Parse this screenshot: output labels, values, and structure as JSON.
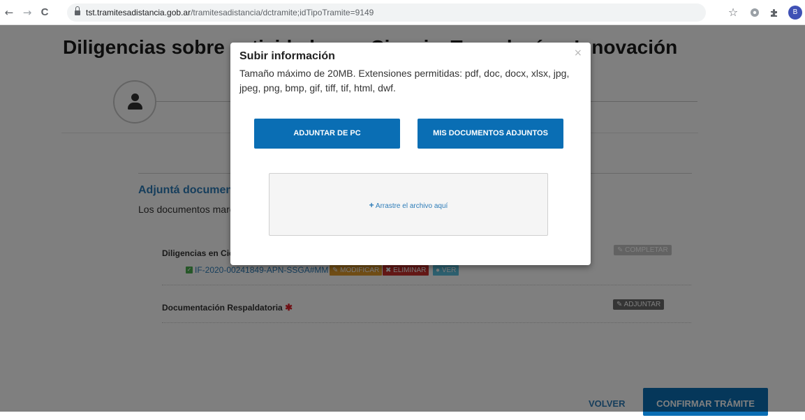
{
  "browser": {
    "back_glyph": "←",
    "forward_glyph": "→",
    "reload_glyph": "C",
    "url_host": "tst.tramitesadistancia.gob.ar",
    "url_path": "/tramitesadistancia/dctramite;idTipoTramite=9149",
    "star_glyph": "☆",
    "profile_initial": "B",
    "icons": [
      "back-icon",
      "forward-icon",
      "reload-icon",
      "lock-icon",
      "star-icon",
      "extension-icon",
      "puzzle-icon",
      "avatar"
    ]
  },
  "page": {
    "title": "Diligencias sobre actividades en Ciencia, Tecnología e Innovación",
    "section_title": "Adjuntá documentación",
    "section_desc": "Los documentos marcados con * son obligatorios",
    "documents": [
      {
        "label": "Diligencias en Ciencia",
        "action_label": "COMPLETAR",
        "attached_file": "IF-2020-00241849-APN-SSGA#MM",
        "file_actions": [
          "MODIFICAR",
          "ELIMINAR",
          "VER"
        ]
      },
      {
        "label": "Documentación Respaldatoria",
        "required_mark": "✱",
        "action_label": "ADJUNTAR"
      }
    ],
    "volver_label": "VOLVER",
    "confirmar_label": "CONFIRMAR TRÁMITE"
  },
  "modal": {
    "title": "Subir información",
    "close_glyph": "×",
    "description": "Tamaño máximo de 20MB. Extensiones permitidas: pdf, doc, docx, xlsx, jpg, jpeg, png, bmp, gif, tiff, tif, html, dwf.",
    "btn_pc": "ADJUNTAR DE PC",
    "btn_docs": "MIS DOCUMENTOS ADJUNTOS",
    "dropzone_plus": "+",
    "dropzone_text": "Arrastre el archivo aquí"
  },
  "colors": {
    "brand_blue": "#0a6eb4",
    "link_blue": "#2d7cb8",
    "required_red": "#e0202a",
    "overlay": "rgba(0,0,0,0.5)"
  }
}
